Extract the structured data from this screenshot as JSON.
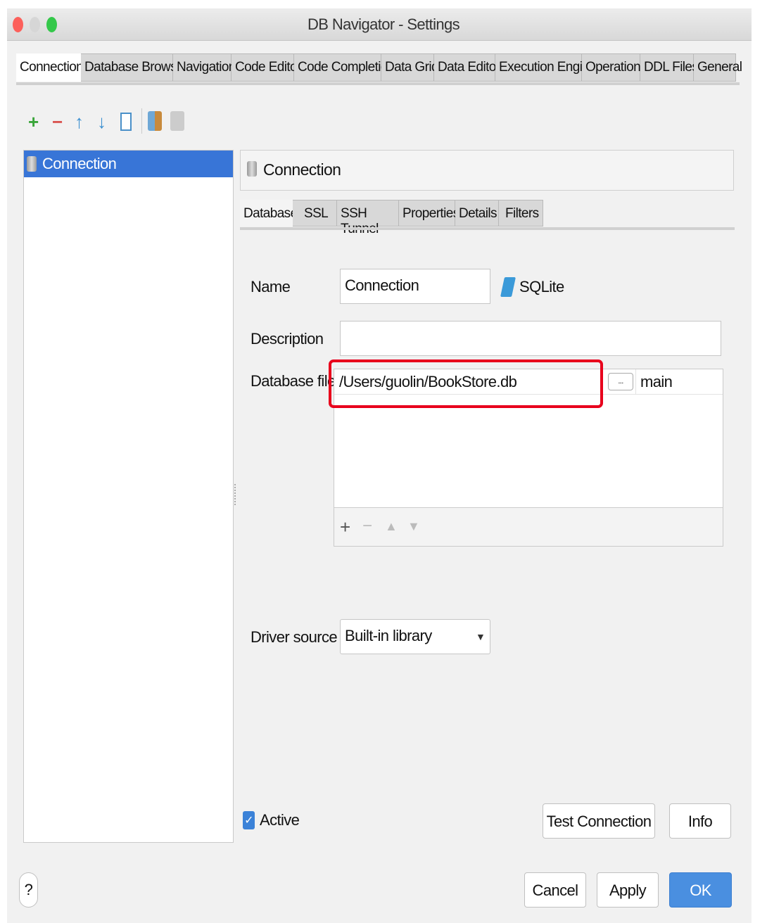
{
  "window": {
    "title": "DB Navigator - Settings"
  },
  "tabs": [
    "Connections",
    "Database Browser",
    "Navigation",
    "Code Editor",
    "Code Completion",
    "Data Grid",
    "Data Editor",
    "Execution Engine",
    "Operations",
    "DDL Files",
    "General"
  ],
  "toolbar": {
    "icons": [
      "add-icon",
      "remove-icon",
      "move-up-icon",
      "move-down-icon",
      "copy-icon",
      "paste-icon",
      "paste-disabled-icon"
    ]
  },
  "tree": {
    "items": [
      {
        "label": "Connection",
        "selected": true
      }
    ]
  },
  "panel": {
    "header": "Connection",
    "subtabs": [
      "Database",
      "SSL",
      "SSH Tunnel",
      "Properties",
      "Details",
      "Filters"
    ],
    "name_label": "Name",
    "name_value": "Connection",
    "db_type": "SQLite",
    "description_label": "Description",
    "description_value": "",
    "files_label": "Database files",
    "file_path": "/Users/guolin/BookStore.db",
    "browse_label": "...",
    "schema": "main",
    "driver_label": "Driver source",
    "driver_value": "Built-in library",
    "active_label": "Active",
    "active_checked": true,
    "test_connection": "Test Connection",
    "info": "Info"
  },
  "footer": {
    "help": "?",
    "cancel": "Cancel",
    "apply": "Apply",
    "ok": "OK"
  },
  "colors": {
    "accent": "#3875d7",
    "highlight": "#e8001c",
    "ok": "#4a8fe0"
  }
}
